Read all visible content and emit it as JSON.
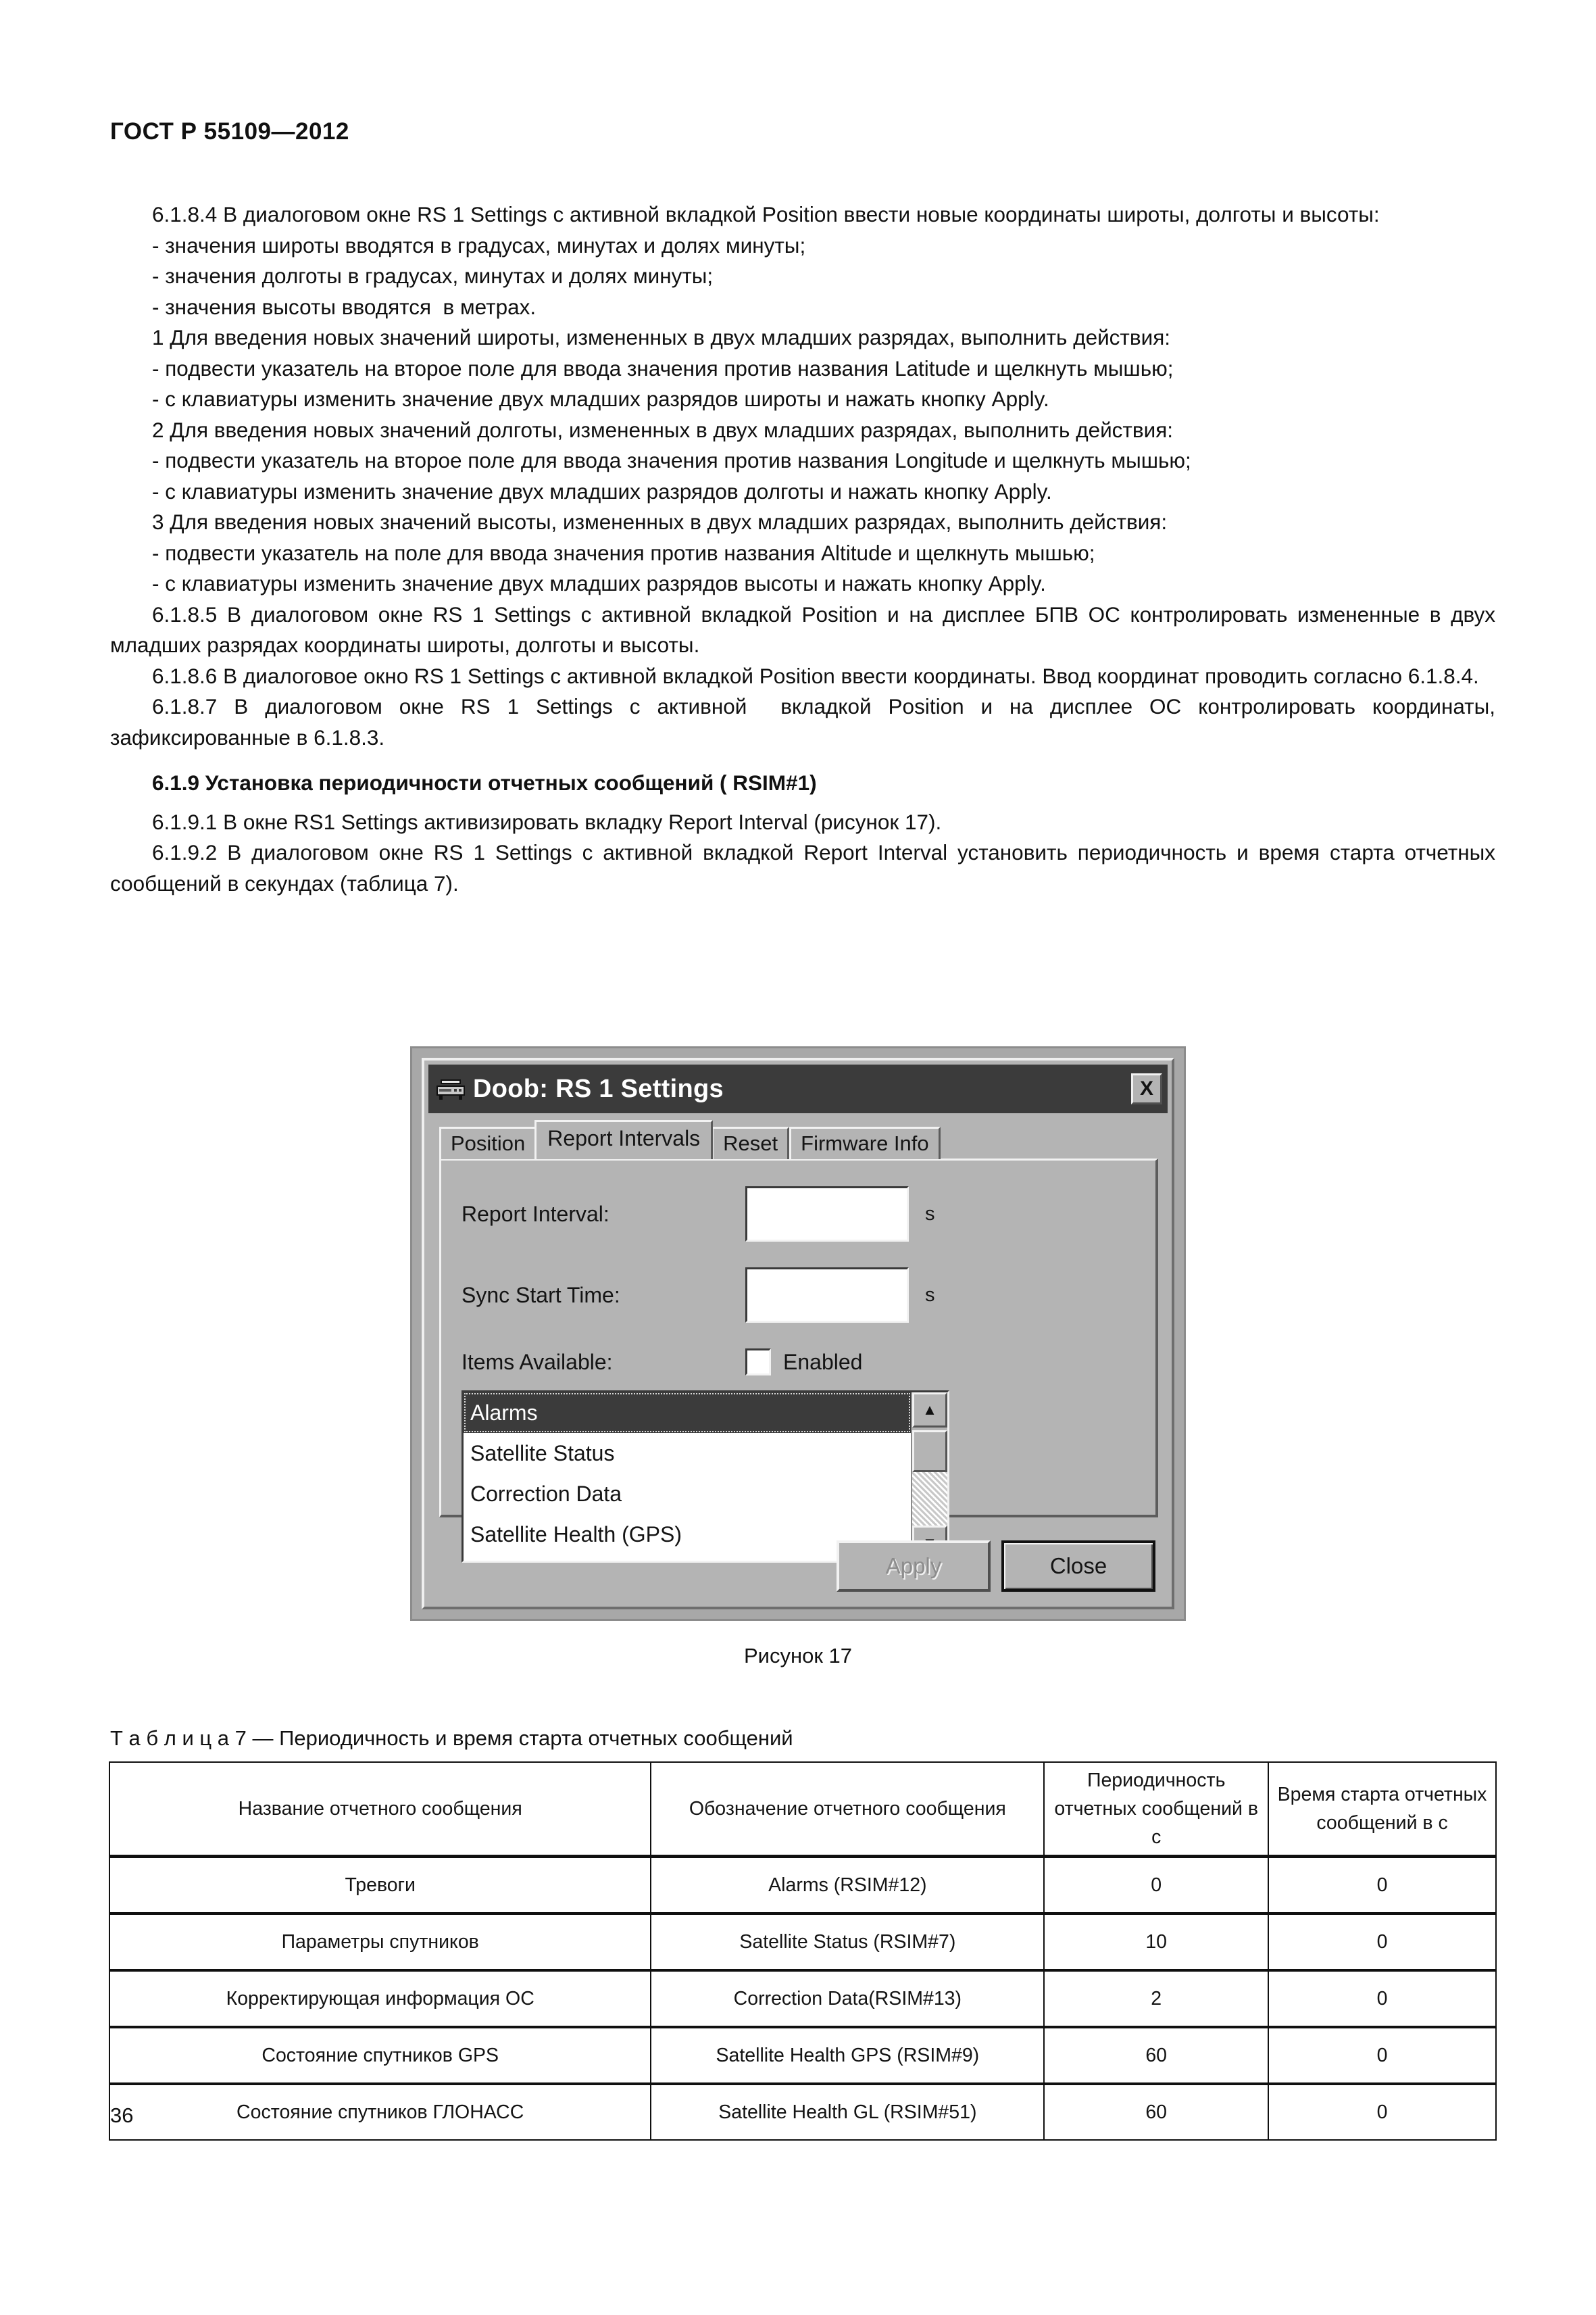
{
  "header": {
    "standard_id": "ГОСТ Р 55109—2012"
  },
  "body": {
    "paragraphs": [
      "6.1.8.4 В диалоговом окне RS 1 Settings с активной вкладкой Position ввести новые координаты широты, долготы и высоты:",
      "- значения широты вводятся в градусах, минутах и долях минуты;",
      "- значения долготы в градусах, минутах и долях минуты;",
      "- значения высоты вводятся  в метрах.",
      "1 Для введения новых значений широты, измененных в двух младших разрядах, выполнить действия:",
      "- подвести указатель на второе поле для ввода значения против названия Latitude и щелкнуть мышью;",
      "- с клавиатуры изменить значение двух младших разрядов широты и нажать кнопку Apply.",
      "2 Для введения новых значений долготы, измененных в двух младших разрядах, выполнить действия:",
      "- подвести указатель на второе поле для ввода значения против названия Longitude и щелкнуть мышью;",
      "- с клавиатуры изменить значение двух младших разрядов долготы и нажать кнопку Apply.",
      "3 Для введения новых значений высоты, измененных в двух младших разрядах, выполнить действия:",
      "- подвести указатель на поле для ввода значения против названия Altitude и щелкнуть мышью;",
      "- с клавиатуры изменить значение двух младших разрядов высоты и нажать кнопку Apply.",
      "6.1.8.5 В диалоговом окне RS 1 Settings с активной вкладкой Position и на дисплее БПВ ОС контролировать измененные в двух младших разрядах координаты широты, долготы и высоты.",
      "6.1.8.6 В диалоговое окно RS 1 Settings с активной вкладкой Position ввести координаты. Ввод координат проводить согласно 6.1.8.4.",
      "6.1.8.7 В диалоговом окне RS 1 Settings с активной  вкладкой Position и на дисплее ОС контролировать координаты, зафиксированные в 6.1.8.3."
    ],
    "section_heading": "6.1.9 Установка периодичности отчетных сообщений ( RSIM#1)",
    "paragraphs_after": [
      "6.1.9.1 В окне RS1 Settings активизировать вкладку Report Interval (рисунок 17).",
      "6.1.9.2 В диалоговом окне RS 1 Settings с активной вкладкой Report Interval установить периодичность и время старта отчетных сообщений в секундах (таблица 7)."
    ]
  },
  "figure": {
    "caption": "Рисунок 17",
    "dialog": {
      "title": "Doob: RS 1 Settings",
      "close_label": "X",
      "tabs": [
        {
          "label": "Position",
          "active": false
        },
        {
          "label": "Report Intervals",
          "active": true
        },
        {
          "label": "Reset",
          "active": false
        },
        {
          "label": "Firmware Info",
          "active": false
        }
      ],
      "fields": {
        "report_interval_label": "Report Interval:",
        "report_interval_value": "",
        "report_interval_unit": "s",
        "sync_start_label": "Sync Start Time:",
        "sync_start_value": "",
        "sync_start_unit": "s",
        "items_available_label": "Items Available:",
        "enabled_label": "Enabled",
        "enabled_checked": false
      },
      "list_items": [
        {
          "label": "Alarms",
          "selected": true
        },
        {
          "label": "Satellite Status",
          "selected": false
        },
        {
          "label": "Correction Data",
          "selected": false
        },
        {
          "label": "Satellite Health (GPS)",
          "selected": false
        }
      ],
      "scroll_up_icon": "▲",
      "scroll_down_icon": "▼",
      "buttons": {
        "apply_label": "Apply",
        "close_label": "Close"
      }
    }
  },
  "table": {
    "title": "Т а б л и ц а 7 — Периодичность и время старта отчетных сообщений",
    "headers": [
      "Название отчетного сообщения",
      "Обозначение отчетного\nсообщения",
      "Периодичность\nотчетных сообщений\nв с",
      "Время старта\nотчетных\nсообщений в с"
    ],
    "rows": [
      [
        "Тревоги",
        "Alarms  (RSIM#12)",
        "0",
        "0"
      ],
      [
        "Параметры спутников",
        "Satellite Status (RSIM#7)",
        "10",
        "0"
      ],
      [
        "Корректирующая информация ОС",
        "Correction Data(RSIM#13)",
        "2",
        "0"
      ],
      [
        "Состояние спутников GPS",
        "Satellite Health GPS (RSIM#9)",
        "60",
        "0"
      ],
      [
        "Состояние спутников ГЛОНАСС",
        "Satellite Health GL (RSIM#51)",
        "60",
        "0"
      ]
    ]
  },
  "footer": {
    "page_number": "36"
  }
}
